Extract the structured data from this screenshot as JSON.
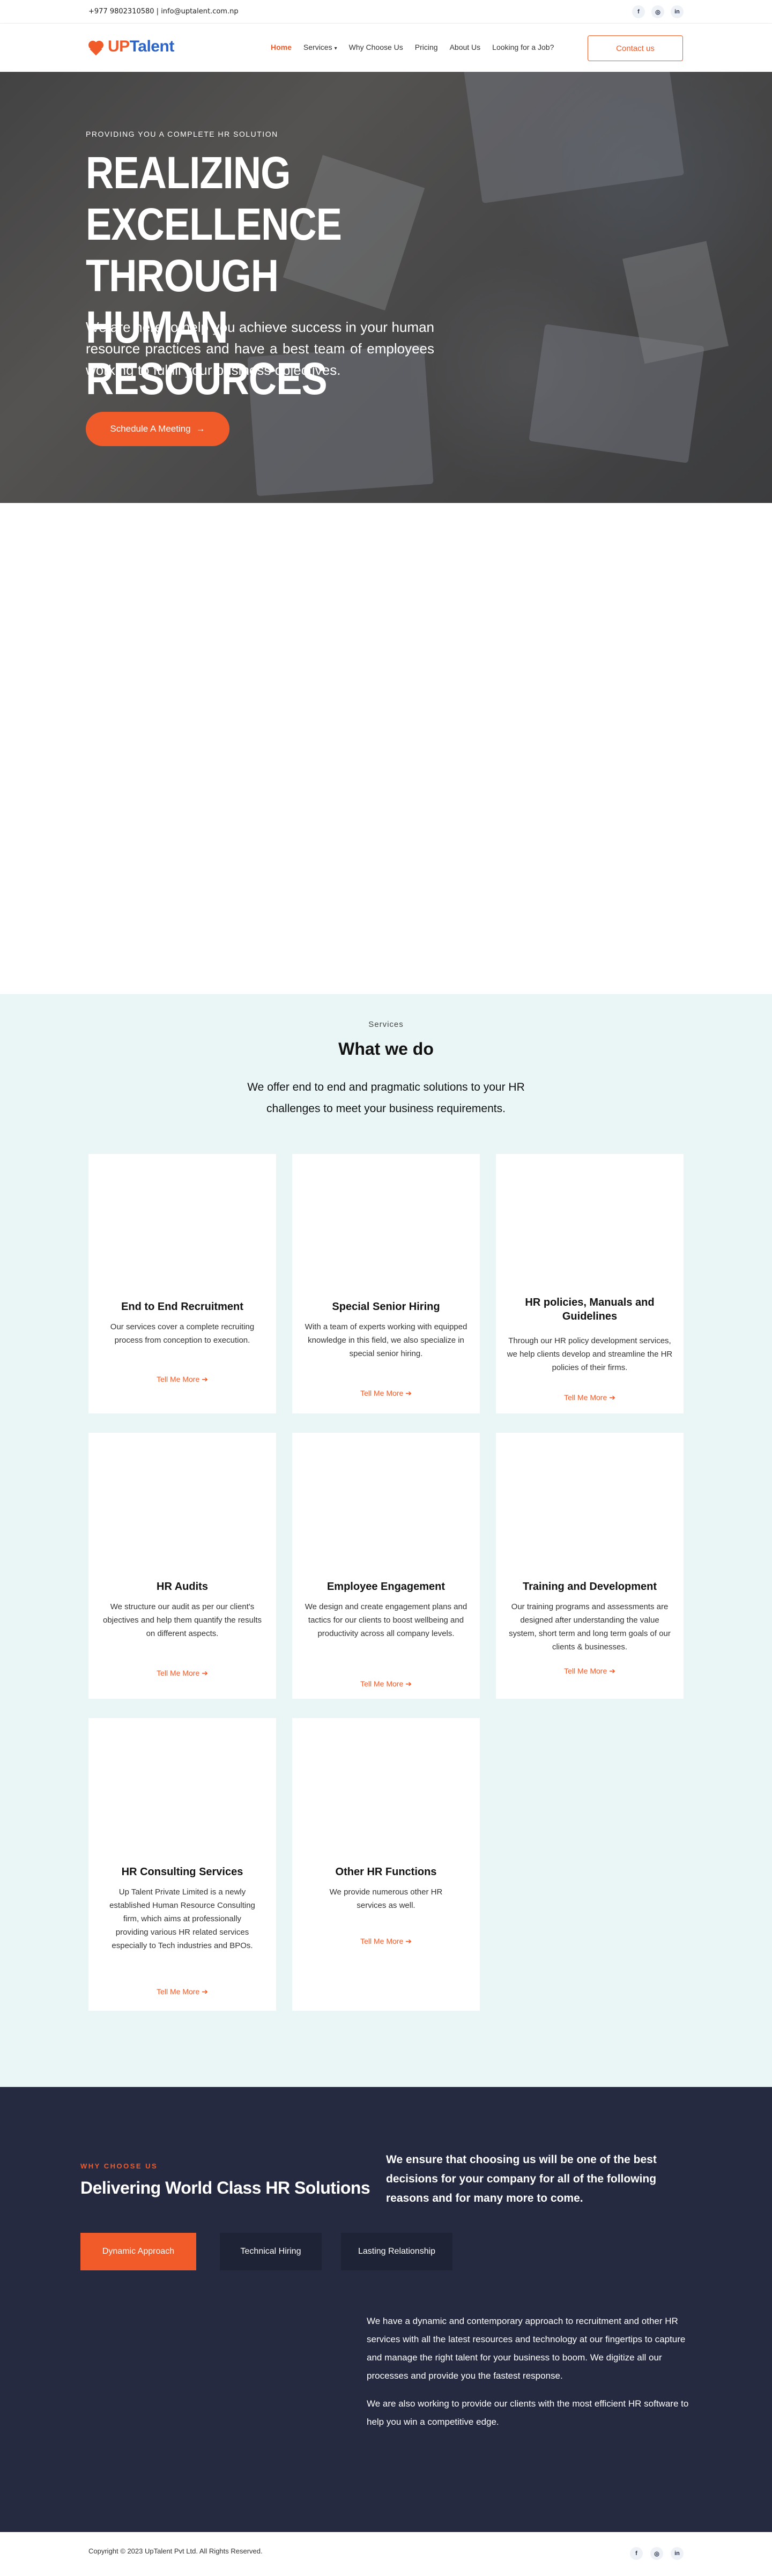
{
  "topbar": {
    "contact": "+977 9802310580 | info@uptalent.com.np",
    "social": [
      {
        "icon": "facebook-icon",
        "glyph": "f"
      },
      {
        "icon": "instagram-icon",
        "glyph": "◎"
      },
      {
        "icon": "linkedin-icon",
        "glyph": "in"
      }
    ]
  },
  "header": {
    "logo": {
      "part1": "UP",
      "part2": "Talent"
    },
    "nav": [
      {
        "label": "Home",
        "active": true
      },
      {
        "label": "Services",
        "caret": "▾"
      },
      {
        "label": "Why Choose Us"
      },
      {
        "label": "Pricing"
      },
      {
        "label": "About Us"
      },
      {
        "label": "Looking for a Job?"
      }
    ],
    "cta": "Contact us"
  },
  "hero": {
    "kicker": "PROVIDING YOU A COMPLETE HR SOLUTION",
    "title_lines": [
      "REALIZING",
      "EXCELLENCE THROUGH",
      "HUMAN RESOURCES"
    ],
    "text": "We are here to help you achieve success in your human resource practices and have a best team of employees working to fulfill your business objectives.",
    "button": "Schedule A Meeting",
    "button_arrow": "→"
  },
  "messenger": {
    "icon": "messenger-icon",
    "glyph": "ϟ"
  },
  "services": {
    "kicker": "Services",
    "title": "What we do",
    "subtitle": "We offer end to end and pragmatic solutions to your HR challenges to meet your business requirements.",
    "link_label": "Tell Me More",
    "link_arrow": "➔",
    "cards": [
      {
        "title": "End to End Recruitment",
        "desc": "Our services cover a complete recruiting process from conception to execution."
      },
      {
        "title": "Special Senior Hiring",
        "desc": "With a team of experts working with equipped knowledge in this field, we also specialize in special senior hiring."
      },
      {
        "title": "HR policies, Manuals and Guidelines",
        "desc": "Through our HR policy development services, we help clients develop and streamline the HR policies of their firms."
      },
      {
        "title": "HR Audits",
        "desc": "We structure our audit as per our client's objectives and help them quantify the results on different aspects."
      },
      {
        "title": "Employee Engagement",
        "desc": "We design and create engagement plans and tactics for our clients to boost wellbeing and productivity across all company levels."
      },
      {
        "title": "Training and Development",
        "desc": "Our training programs and assessments are designed after understanding the value system, short term and long term goals of our clients & businesses."
      },
      {
        "title": "HR Consulting Services",
        "desc": "Up Talent Private Limited is a newly established Human Resource Consulting firm, which aims at professionally providing various HR related services especially to Tech industries and BPOs."
      },
      {
        "title": "Other HR Functions",
        "desc": "We provide numerous other HR services as well."
      }
    ]
  },
  "why": {
    "kicker": "WHY CHOOSE US",
    "title": "Delivering World Class HR Solutions",
    "lead": "We ensure that choosing us will be one of the best decisions for your company for all of the following reasons and for many more to come.",
    "tabs": [
      {
        "label": "Dynamic Approach",
        "active": true
      },
      {
        "label": "Technical Hiring"
      },
      {
        "label": "Lasting Relationship"
      }
    ],
    "p1": "We have a dynamic and contemporary approach to recruitment and other HR services with all the latest resources and technology at our fingertips to capture and manage the right talent for your business to boom. We digitize all our processes and provide you the fastest response.",
    "p2": "We are also working to provide our clients with the most efficient HR software to help you win a competitive edge."
  },
  "footer": {
    "copyright": "Copyright © 2023 UpTalent Pvt Ltd. All Rights Reserved."
  }
}
